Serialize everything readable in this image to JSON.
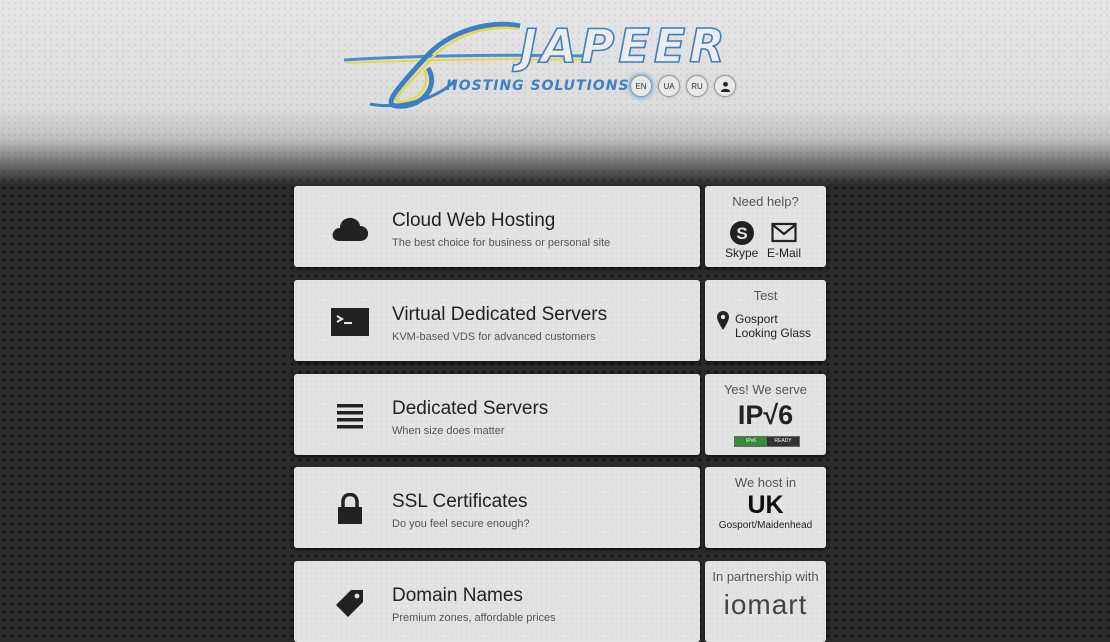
{
  "header": {
    "brand": "JAPEER",
    "tagline": "HOSTING SOLUTIONS",
    "languages": [
      {
        "label": "EN",
        "active": true
      },
      {
        "label": "UA",
        "active": false
      },
      {
        "label": "RU",
        "active": false
      }
    ],
    "account_icon": "user-icon",
    "colors": {
      "brand_blue": "#3b7fc4",
      "logo_yellow": "#e6d64a"
    }
  },
  "services": [
    {
      "title": "Cloud Web Hosting",
      "subtitle": "The best choice for business or personal site",
      "icon": "cloud-icon"
    },
    {
      "title": "Virtual Dedicated Servers",
      "subtitle": "KVM-based VDS for advanced customers",
      "icon": "terminal-icon"
    },
    {
      "title": "Dedicated Servers",
      "subtitle": "When size does matter",
      "icon": "server-list-icon"
    },
    {
      "title": "SSL Certificates",
      "subtitle": "Do you feel secure enough?",
      "icon": "lock-icon"
    },
    {
      "title": "Domain Names",
      "subtitle": "Premium zones, affordable prices",
      "icon": "tag-icon"
    }
  ],
  "side": {
    "help": {
      "caption": "Need help?",
      "skype": "Skype",
      "email": "E-Mail"
    },
    "test": {
      "caption": "Test",
      "line1": "Gosport",
      "line2": "Looking Glass"
    },
    "ipv6": {
      "caption": "Yes! We serve",
      "text": "IP√6",
      "badge_left": "IPv6",
      "badge_right": "READY"
    },
    "location": {
      "caption": "We host in",
      "country": "UK",
      "cities": "Gosport/Maidenhead"
    },
    "partner": {
      "caption": "In partnership with",
      "name": "iomart"
    }
  }
}
